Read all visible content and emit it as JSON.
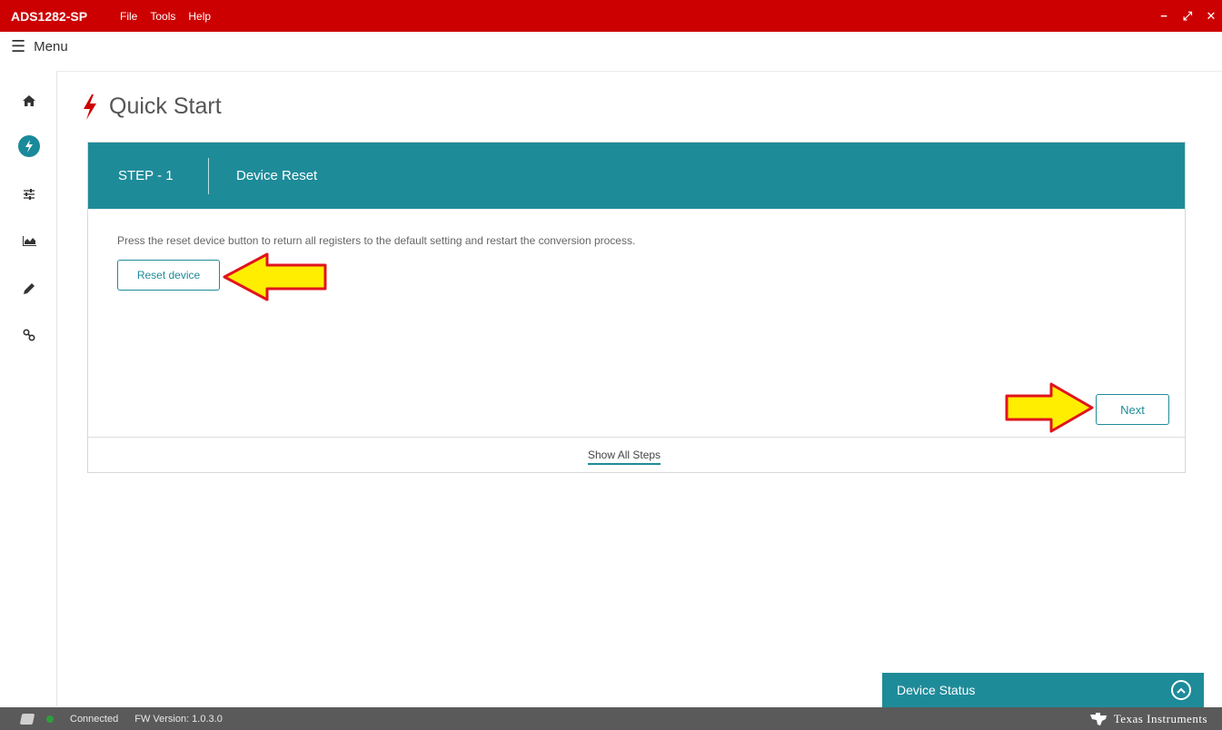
{
  "window": {
    "app_title": "ADS1282-SP",
    "menu": [
      "File",
      "Tools",
      "Help"
    ],
    "controls": {
      "minimize": "−",
      "maximize": "⤢",
      "close": "✕"
    }
  },
  "menubar": {
    "label": "Menu"
  },
  "sidebar": {
    "items": [
      {
        "name": "home-icon",
        "active": false
      },
      {
        "name": "quick-start-icon",
        "active": true
      },
      {
        "name": "settings-sliders-icon",
        "active": false
      },
      {
        "name": "chart-area-icon",
        "active": false
      },
      {
        "name": "pencil-icon",
        "active": false
      },
      {
        "name": "link-icon",
        "active": false
      }
    ]
  },
  "page": {
    "title": "Quick Start"
  },
  "step": {
    "number_label": "STEP - 1",
    "title": "Device Reset",
    "description": "Press the reset device button to return all registers to the default setting and restart the conversion process.",
    "reset_button_label": "Reset device",
    "next_button_label": "Next",
    "show_all_steps_label": "Show All Steps"
  },
  "device_status": {
    "label": "Device Status"
  },
  "statusbar": {
    "connection_text": "Connected",
    "fw_version_text": "FW Version: 1.0.3.0",
    "brand": "Texas Instruments"
  },
  "colors": {
    "titlebar": "#cc0000",
    "accent_teal": "#1e8b99",
    "statusbar": "#5a5a5a",
    "annotation_arrow_fill": "#ffee00",
    "annotation_arrow_stroke": "#e0141e"
  }
}
